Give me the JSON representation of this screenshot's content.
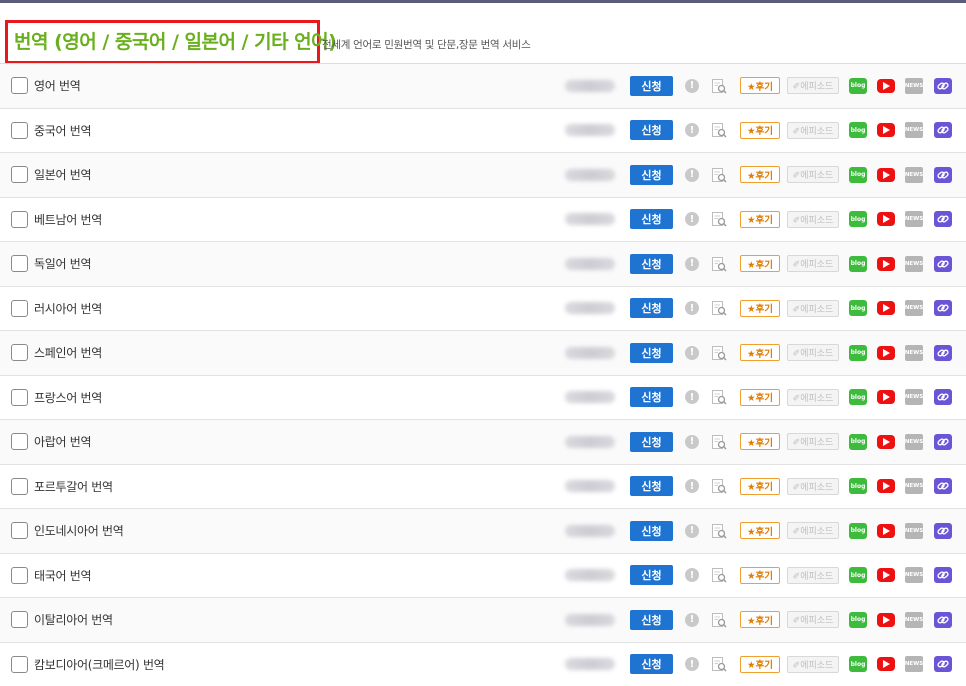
{
  "header": {
    "title": "번역 (영어 / 중국어 / 일본어 / 기타 언어)",
    "subtitle": "전세계 언어로 민원번역 및 단문,장문 번역 서비스"
  },
  "labels": {
    "apply": "신청",
    "review": "★후기",
    "episode": "✐에피소드",
    "blog": "blog",
    "news": "NEWS"
  },
  "colors": {
    "title": "#6aaf1e",
    "highlight_border": "#e8181b",
    "apply_button": "#1f74d1",
    "review_border": "#f0a030",
    "blog": "#3dbb3d",
    "youtube": "#ee1111",
    "link": "#6b55d6"
  },
  "services": [
    {
      "name": "영어 번역"
    },
    {
      "name": "중국어 번역"
    },
    {
      "name": "일본어 번역"
    },
    {
      "name": "베트남어 번역"
    },
    {
      "name": "독일어 번역"
    },
    {
      "name": "러시아어 번역"
    },
    {
      "name": "스페인어 번역"
    },
    {
      "name": "프랑스어 번역"
    },
    {
      "name": "아랍어 번역"
    },
    {
      "name": "포르투갈어 번역"
    },
    {
      "name": "인도네시아어 번역"
    },
    {
      "name": "태국어 번역"
    },
    {
      "name": "이탈리아어 번역"
    },
    {
      "name": "캄보디아어(크메르어) 번역"
    }
  ]
}
